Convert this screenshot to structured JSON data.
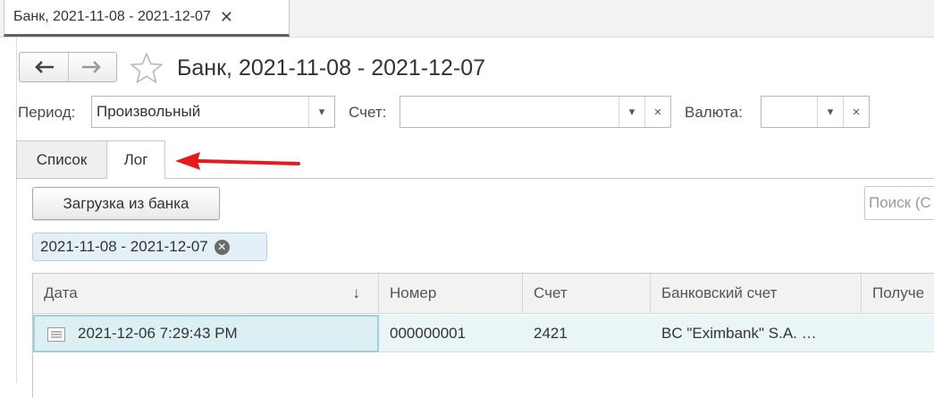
{
  "tabstrip": {
    "tab_label": "Банк, 2021-11-08 - 2021-12-07",
    "close_glyph": "✕"
  },
  "header": {
    "title": "Банк, 2021-11-08 - 2021-12-07"
  },
  "filters": {
    "period_label": "Период:",
    "period_value": "Произвольный",
    "account_label": "Счет:",
    "account_value": "",
    "currency_label": "Валюта:",
    "currency_value": "",
    "dropdown_glyph": "▾",
    "clear_glyph": "×"
  },
  "tabs": [
    {
      "label": "Список",
      "active": false
    },
    {
      "label": "Лог",
      "active": true
    }
  ],
  "toolbar": {
    "load_button_label": "Загрузка из банка",
    "search_placeholder": "Поиск (Ctrl+F)",
    "search_visible_text": "Поиск (С"
  },
  "active_filter_chip": {
    "label": "2021-11-08 - 2021-12-07",
    "remove_glyph": "✕"
  },
  "table": {
    "columns": [
      {
        "label": "Дата",
        "sort_indicator": "↓"
      },
      {
        "label": "Номер"
      },
      {
        "label": "Счет"
      },
      {
        "label": "Банковский счет"
      },
      {
        "label": "Получе"
      }
    ],
    "rows": [
      {
        "date": "2021-12-06 7:29:43 PM",
        "number": "000000001",
        "account": "2421",
        "bank_account": "BC \"Eximbank\" S.A. …",
        "receiver": ""
      }
    ]
  },
  "colors": {
    "annotation_arrow": "#e8191b",
    "selected_row": "#eaf5f7",
    "chip_background": "#e3f0f8"
  },
  "icons": {
    "back": "arrow-left-icon",
    "forward": "arrow-right-icon",
    "favorite": "star-icon",
    "row": "document-icon"
  }
}
